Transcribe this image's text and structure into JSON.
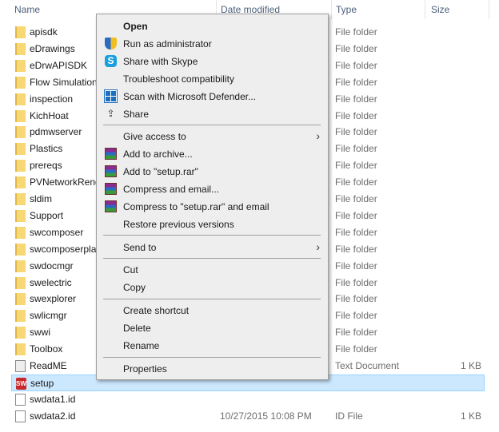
{
  "columns": {
    "name": "Name",
    "date": "Date modified",
    "type": "Type",
    "size": "Size"
  },
  "files": [
    {
      "name": "apisdk",
      "date": "",
      "type": "File folder",
      "size": "",
      "icon": "folder"
    },
    {
      "name": "eDrawings",
      "date": "",
      "type": "File folder",
      "size": "",
      "icon": "folder"
    },
    {
      "name": "eDrwAPISDK",
      "date": "",
      "type": "File folder",
      "size": "",
      "icon": "folder"
    },
    {
      "name": "Flow Simulation",
      "date": "",
      "type": "File folder",
      "size": "",
      "icon": "folder"
    },
    {
      "name": "inspection",
      "date": "",
      "type": "File folder",
      "size": "",
      "icon": "folder"
    },
    {
      "name": "KichHoat",
      "date": "",
      "type": "File folder",
      "size": "",
      "icon": "folder"
    },
    {
      "name": "pdmwserver",
      "date": "",
      "type": "File folder",
      "size": "",
      "icon": "folder"
    },
    {
      "name": "Plastics",
      "date": "",
      "type": "File folder",
      "size": "",
      "icon": "folder"
    },
    {
      "name": "prereqs",
      "date": "",
      "type": "File folder",
      "size": "",
      "icon": "folder"
    },
    {
      "name": "PVNetworkRend",
      "date": "",
      "type": "File folder",
      "size": "",
      "icon": "folder"
    },
    {
      "name": "sldim",
      "date": "",
      "type": "File folder",
      "size": "",
      "icon": "folder"
    },
    {
      "name": "Support",
      "date": "",
      "type": "File folder",
      "size": "",
      "icon": "folder"
    },
    {
      "name": "swcomposer",
      "date": "",
      "type": "File folder",
      "size": "",
      "icon": "folder"
    },
    {
      "name": "swcomposerpla",
      "date": "",
      "type": "File folder",
      "size": "",
      "icon": "folder"
    },
    {
      "name": "swdocmgr",
      "date": "",
      "type": "File folder",
      "size": "",
      "icon": "folder"
    },
    {
      "name": "swelectric",
      "date": "",
      "type": "File folder",
      "size": "",
      "icon": "folder"
    },
    {
      "name": "swexplorer",
      "date": "",
      "type": "File folder",
      "size": "",
      "icon": "folder"
    },
    {
      "name": "swlicmgr",
      "date": "",
      "type": "File folder",
      "size": "",
      "icon": "folder"
    },
    {
      "name": "swwi",
      "date": "",
      "type": "File folder",
      "size": "",
      "icon": "folder"
    },
    {
      "name": "Toolbox",
      "date": "",
      "type": "File folder",
      "size": "",
      "icon": "folder"
    },
    {
      "name": "ReadME",
      "date": "",
      "type": "Text Document",
      "size": "1 KB",
      "icon": "text-document"
    },
    {
      "name": "setup",
      "date": "",
      "type": "",
      "size": "",
      "icon": "solidworks-app",
      "selected": true
    },
    {
      "name": "swdata1.id",
      "date": "",
      "type": "",
      "size": "",
      "icon": "file"
    },
    {
      "name": "swdata2.id",
      "date": "10/27/2015 10:08 PM",
      "type": "ID File",
      "size": "1 KB",
      "icon": "file"
    }
  ],
  "context_menu": {
    "open": "Open",
    "run_as_admin": "Run as administrator",
    "share_skype": "Share with Skype",
    "troubleshoot": "Troubleshoot compatibility",
    "scan_defender": "Scan with Microsoft Defender...",
    "share": "Share",
    "give_access": "Give access to",
    "add_archive": "Add to archive...",
    "add_setup_rar": "Add to \"setup.rar\"",
    "compress_email": "Compress and email...",
    "compress_setup_email": "Compress to \"setup.rar\" and email",
    "restore_versions": "Restore previous versions",
    "send_to": "Send to",
    "cut": "Cut",
    "copy": "Copy",
    "create_shortcut": "Create shortcut",
    "delete": "Delete",
    "rename": "Rename",
    "properties": "Properties",
    "submenu_arrow": "›",
    "skype_glyph": "S"
  },
  "colors": {
    "selection": "#cce8ff",
    "menu_bg": "#eeeeee",
    "folder": "#f8d775"
  }
}
